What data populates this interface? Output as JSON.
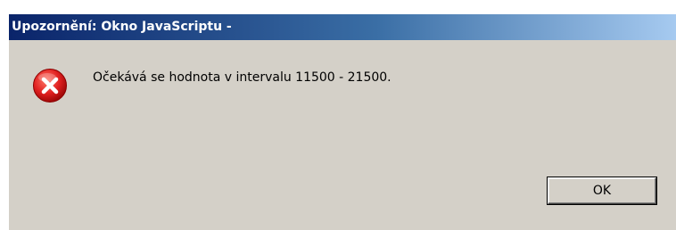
{
  "dialog": {
    "title": "Upozornění: Okno JavaScriptu -",
    "message": "Očekává se hodnota v intervalu 11500 - 21500.",
    "icon": "error-icon",
    "ok_label": "OK"
  },
  "colors": {
    "titlebar_start": "#0a246a",
    "titlebar_end": "#a6caf0",
    "dialog_background": "#d4d0c8",
    "error_red": "#e02020"
  }
}
